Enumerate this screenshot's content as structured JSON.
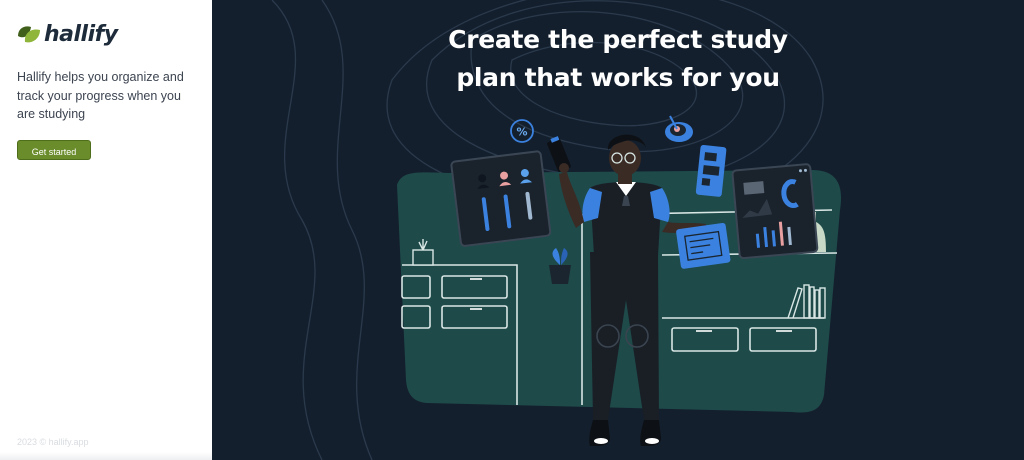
{
  "brand": {
    "name": "hallify",
    "logo_icon": "leaf-logo-icon",
    "colors": {
      "leaf_dark": "#3f5f1a",
      "leaf_light": "#8fb63a",
      "text": "#1d2b3a"
    }
  },
  "sidebar": {
    "tagline": "Hallify helps you organize and track your progress when you are studying",
    "cta_label": "Get started",
    "footer": "2023 © hallify.app",
    "colors": {
      "cta_bg": "#6a8c2a"
    }
  },
  "hero": {
    "title_line1": "Create the perfect study",
    "title_line2": "plan that works for you",
    "background": "#141f2d",
    "illustration": "student-with-dashboards-illustration"
  }
}
